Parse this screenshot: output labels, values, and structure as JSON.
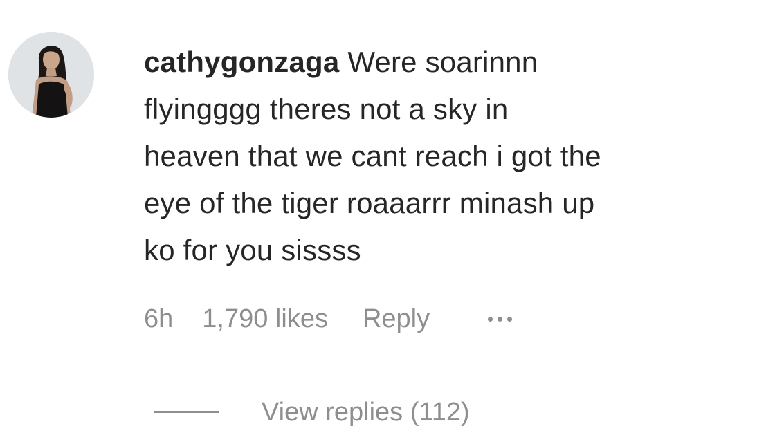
{
  "comment": {
    "avatar_icon": "profile-photo-avatar",
    "username": "cathygonzaga",
    "lines": [
      " Were soarinnn",
      "flyingggg theres not a sky in",
      "heaven that we cant reach i got the",
      "eye of the tiger roaaarrr minash up",
      "ko for you sissss"
    ],
    "time": "6h",
    "likes": "1,790 likes",
    "reply_label": "Reply",
    "more_icon": "more-options-icon"
  },
  "replies": {
    "label": "View replies (112)"
  },
  "colors": {
    "text": "#262626",
    "secondary": "#8e8e8e",
    "background": "#ffffff"
  }
}
